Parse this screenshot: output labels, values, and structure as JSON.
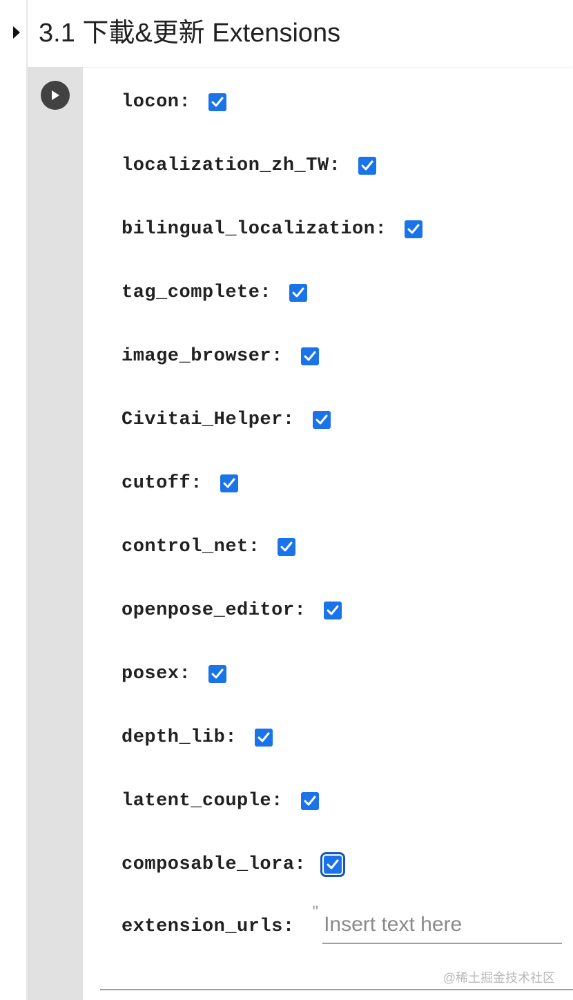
{
  "cell": {
    "title": "3.1 下載&更新 Extensions",
    "collapse_icon": "triangle-right-icon",
    "run_icon": "play-circle-icon"
  },
  "form": {
    "fields": [
      {
        "label": "locon:",
        "checked": true
      },
      {
        "label": "localization_zh_TW:",
        "checked": true
      },
      {
        "label": "bilingual_localization:",
        "checked": true
      },
      {
        "label": "tag_complete:",
        "checked": true
      },
      {
        "label": "image_browser:",
        "checked": true
      },
      {
        "label": "Civitai_Helper:",
        "checked": true
      },
      {
        "label": "cutoff:",
        "checked": true
      },
      {
        "label": "control_net:",
        "checked": true
      },
      {
        "label": "openpose_editor:",
        "checked": true
      },
      {
        "label": "posex:",
        "checked": true
      },
      {
        "label": "depth_lib:",
        "checked": true
      },
      {
        "label": "latent_couple:",
        "checked": true
      },
      {
        "label": "composable_lora:",
        "checked": true,
        "focused": true
      }
    ],
    "extension_urls": {
      "label": "extension_urls:",
      "quote": "\"",
      "value": "",
      "placeholder": "Insert text here"
    }
  },
  "watermark": "@稀土掘金技术社区",
  "colors": {
    "checkbox": "#1a73e8",
    "gutter": "#e1e1e1",
    "run_button": "#424242"
  }
}
